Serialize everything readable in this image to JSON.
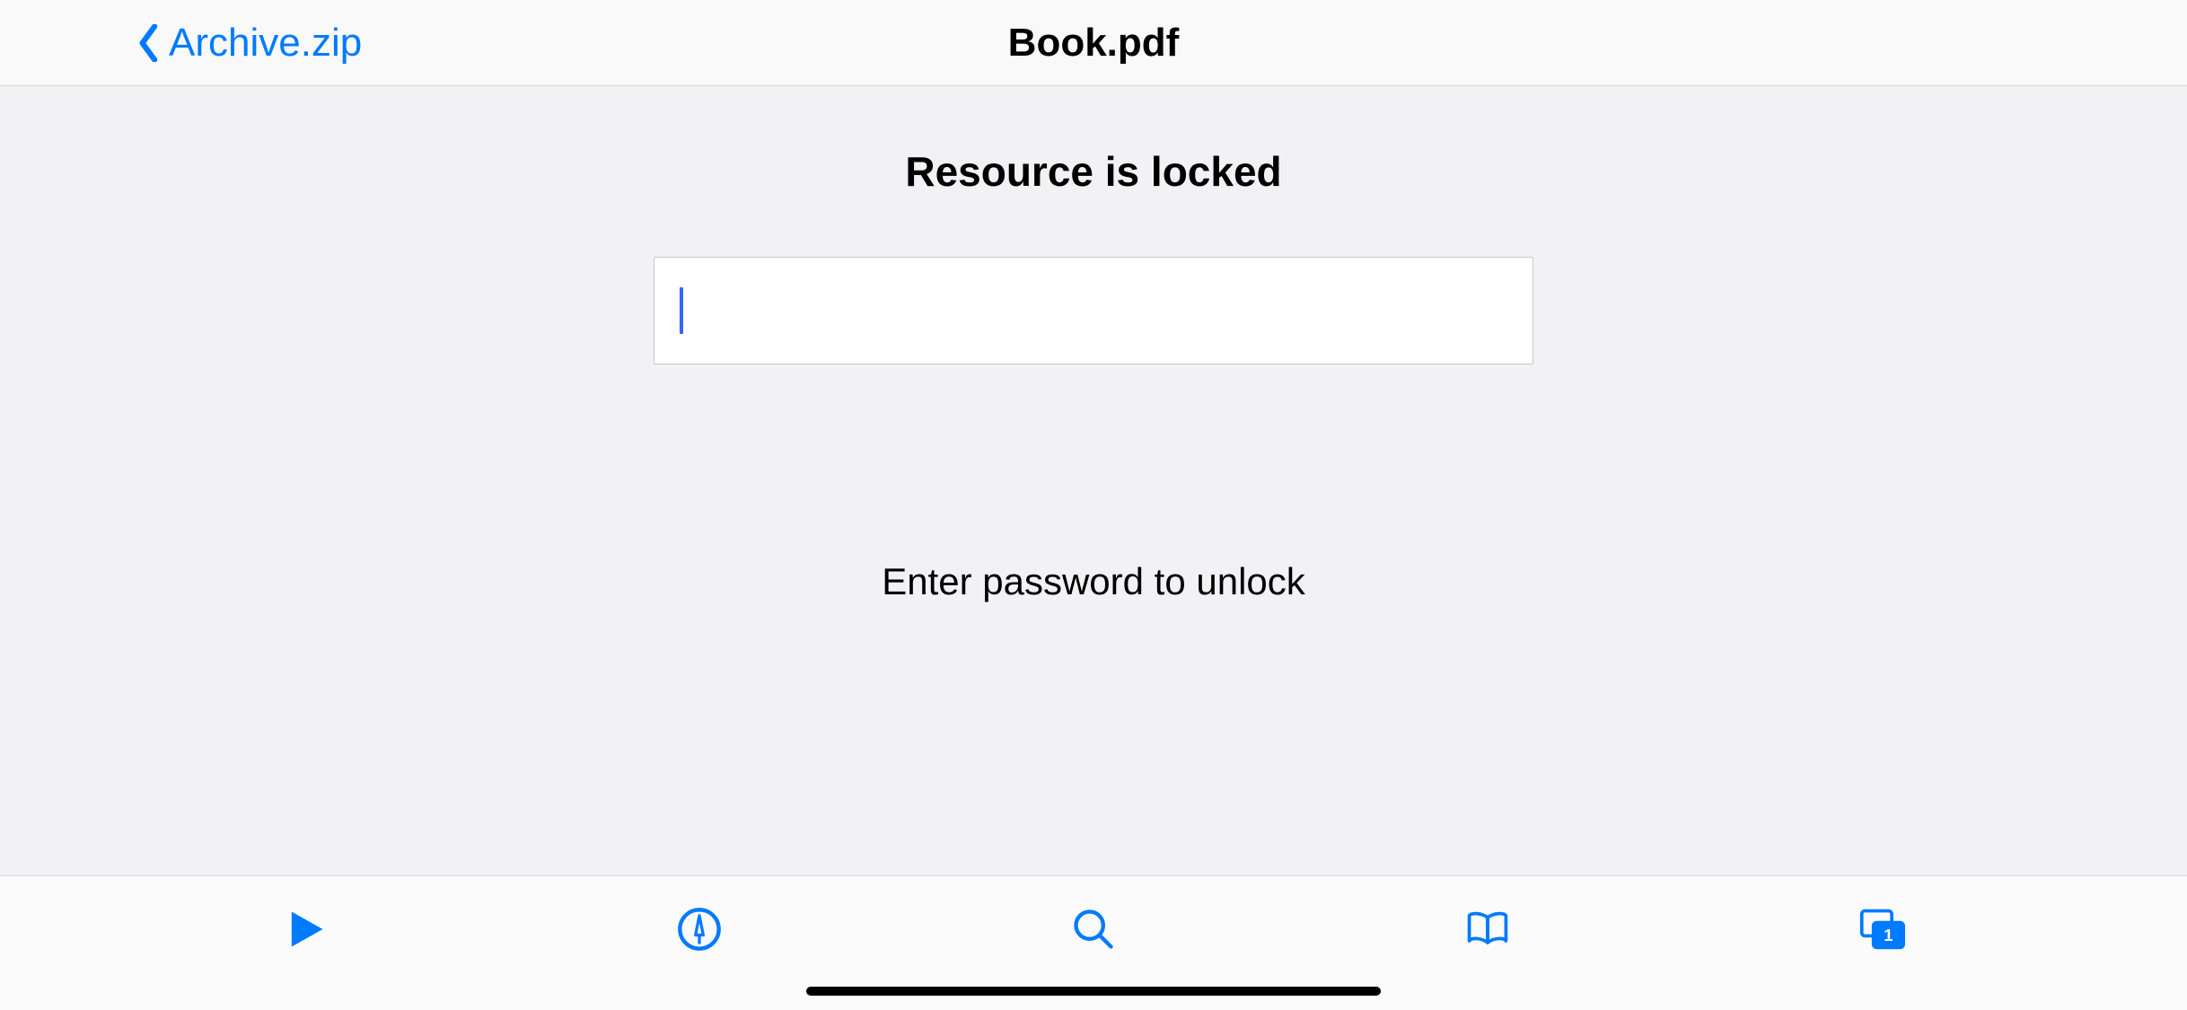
{
  "nav": {
    "back_label": "Archive.zip",
    "title": "Book.pdf"
  },
  "main": {
    "lock_title": "Resource is locked",
    "password_value": "",
    "password_placeholder": "",
    "hint": "Enter password to unlock"
  },
  "toolbar": {
    "items": [
      {
        "name": "play-icon"
      },
      {
        "name": "annotate-icon"
      },
      {
        "name": "search-icon"
      },
      {
        "name": "bookmarks-icon"
      },
      {
        "name": "tabs-icon",
        "badge": "1"
      }
    ]
  },
  "colors": {
    "accent": "#007aff",
    "bg": "#f2f2f4",
    "bar_bg": "#f9f9f9"
  }
}
